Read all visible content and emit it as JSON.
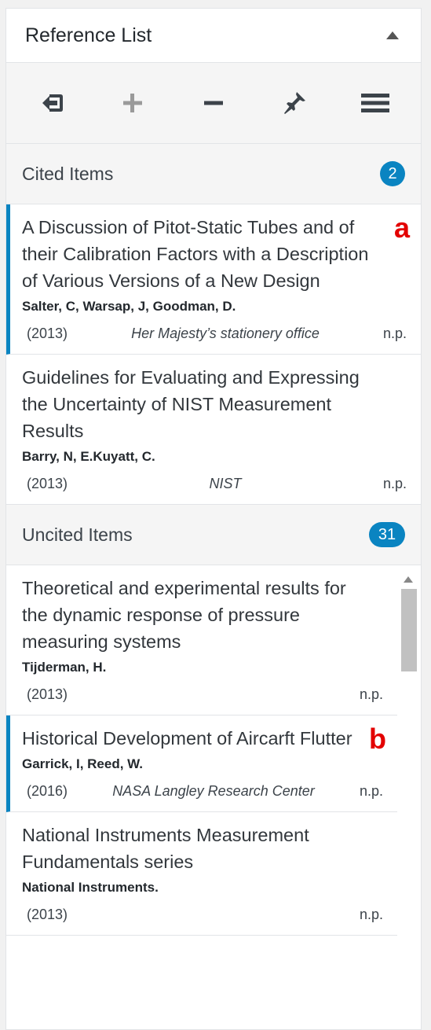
{
  "panel": {
    "title": "Reference List"
  },
  "toolbar": {
    "buttons": [
      {
        "name": "insert-citation-button",
        "icon": "sign-in-icon"
      },
      {
        "name": "add-reference-button",
        "icon": "plus-icon"
      },
      {
        "name": "remove-reference-button",
        "icon": "minus-icon"
      },
      {
        "name": "pin-button",
        "icon": "pin-icon"
      },
      {
        "name": "menu-button",
        "icon": "hamburger-icon"
      }
    ]
  },
  "cited": {
    "label": "Cited Items",
    "count": "2",
    "items": [
      {
        "title": "A Discussion of Pitot-Static Tubes and of their Calibration Factors with a Description of Various Versions of a New Design",
        "authors": "Salter, C, Warsap, J, Goodman, D.",
        "year": "(2013)",
        "publisher": "Her Majesty’s stationery office",
        "pages": "n.p.",
        "marker": "a"
      },
      {
        "title": "Guidelines for Evaluating and Expressing the Uncertainty of NIST Measurement Results",
        "authors": "Barry, N, E.Kuyatt, C.",
        "year": "(2013)",
        "publisher": "NIST",
        "pages": "n.p."
      }
    ]
  },
  "uncited": {
    "label": "Uncited Items",
    "count": "31",
    "items": [
      {
        "title": "Theoretical and experimental results for the dynamic response of pressure measuring systems",
        "authors": "Tijderman, H.",
        "year": "(2013)",
        "publisher": "",
        "pages": "n.p."
      },
      {
        "title": "Historical Development of Aircarft Flutter",
        "authors": "Garrick, I, Reed, W.",
        "year": "(2016)",
        "publisher": "NASA Langley Research Center",
        "pages": "n.p.",
        "marker": "b"
      },
      {
        "title": "National Instruments Measurement Fundamentals series",
        "authors": "National Instruments.",
        "year": "(2013)",
        "publisher": "",
        "pages": "n.p."
      }
    ]
  },
  "colors": {
    "accent": "#0a84c1",
    "marker": "#e30000"
  }
}
